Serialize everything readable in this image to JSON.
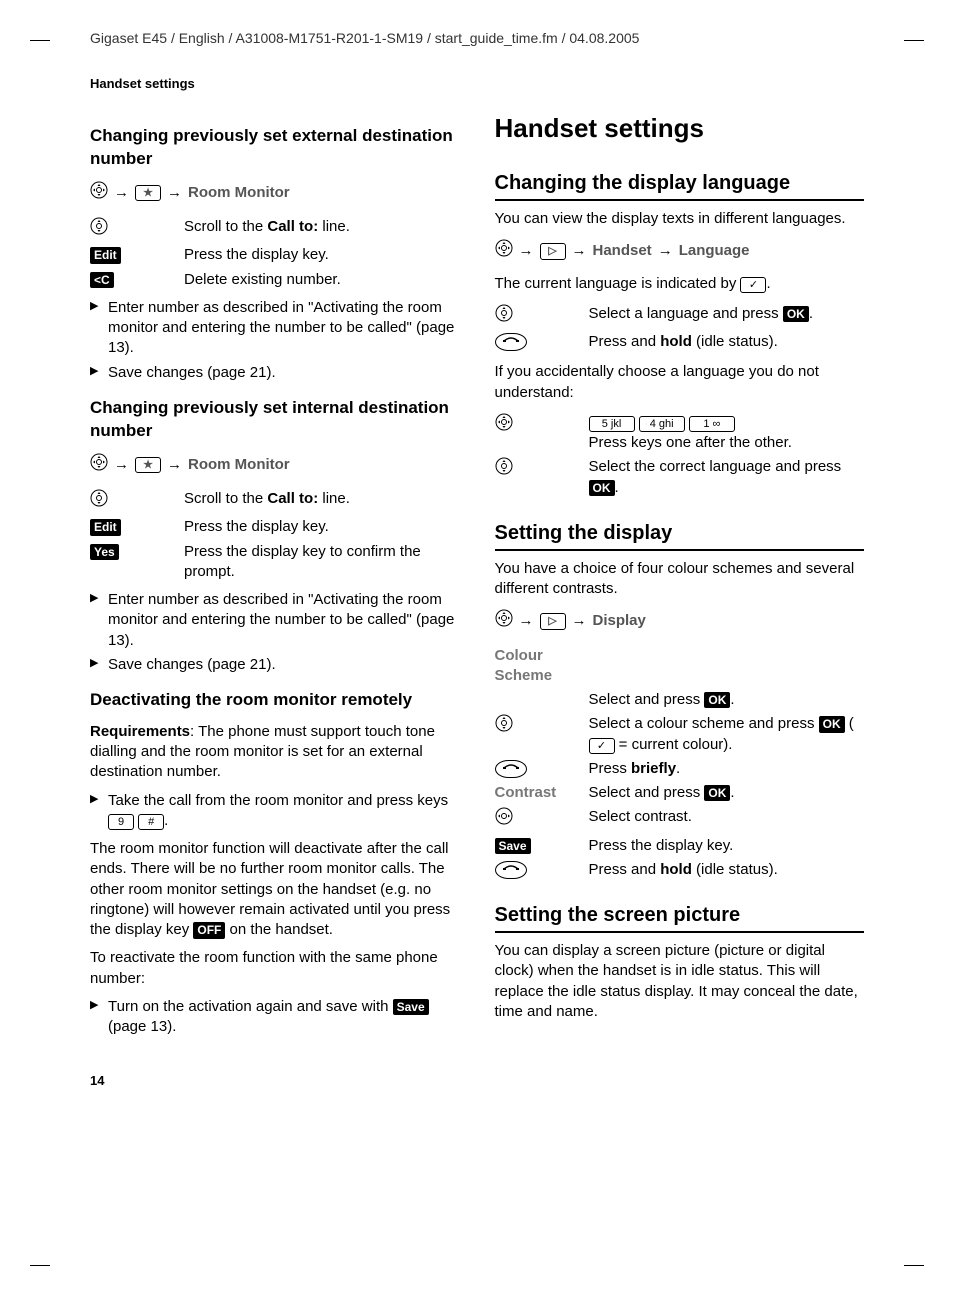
{
  "header": "Gigaset E45 / English / A31008-M1751-R201-1-SM19 / start_guide_time.fm / 04.08.2005",
  "running_head": "Handset settings",
  "page_number": "14",
  "icons": {
    "nav_wheel": "nav-wheel-icon",
    "arrow": "→",
    "star_box": "★",
    "menu_box": "▷",
    "hangup": "hangup-icon",
    "check_box": "✓"
  },
  "left": {
    "h3a": "Changing previously set external destination number",
    "path_a_item": "Room Monitor",
    "rows_a": [
      {
        "k": "nav",
        "t": "Scroll to the ",
        "t2": "Call to:",
        "t3": " line."
      },
      {
        "k": "Edit",
        "t": "Press the display key."
      },
      {
        "k": "clear",
        "t": "Delete existing number."
      }
    ],
    "bullets_a": [
      "Enter number as described in \"Activating the room monitor and entering the number to be called\" (page 13).",
      "Save changes (page 21)."
    ],
    "h3b": "Changing previously set internal destination number",
    "path_b_item": "Room Monitor",
    "rows_b": [
      {
        "k": "nav",
        "t": "Scroll to the ",
        "t2": "Call to:",
        "t3": " line."
      },
      {
        "k": "Edit",
        "t": "Press the display key."
      },
      {
        "k": "Yes",
        "t": "Press the display key to confirm the prompt."
      }
    ],
    "bullets_b": [
      "Enter number as described in \"Activating the room monitor and entering the number to be called\" (page 13).",
      "Save changes (page 21)."
    ],
    "h3c": "Deactivating the room monitor remotely",
    "req_label": "Requirements",
    "req_text": ": The phone must support touch tone dialling and the room monitor is set for an external destination number.",
    "bullet_c1_a": "Take the call from the room monitor and press keys ",
    "bullet_c1_keys": [
      "9",
      "#"
    ],
    "bullet_c1_b": ".",
    "para_c2_a": "The room monitor function will deactivate after the call ends. There will be no further room monitor calls. The other room monitor settings on the handset (e.g. no ringtone) will however remain activated until you press the display key ",
    "para_c2_key": "OFF",
    "para_c2_b": " on the handset.",
    "para_c3": "To reactivate the room function with the same phone number:",
    "bullet_c4_a": "Turn on the activation again and save with ",
    "bullet_c4_key": "Save",
    "bullet_c4_b": " (page 13)."
  },
  "right": {
    "h1": "Handset settings",
    "h2a": "Changing the display language",
    "p_a1": "You can view the display texts in different languages.",
    "path_a": [
      "Handset",
      "Language"
    ],
    "p_a2_a": "The current language is indicated by ",
    "p_a2_b": ".",
    "rows_a": [
      {
        "k": "nav",
        "t_a": "Select a language and press ",
        "key": "OK",
        "t_b": "."
      },
      {
        "k": "hangup",
        "t_a": "Press and ",
        "bold": "hold",
        "t_b": " (idle status)."
      }
    ],
    "p_a3": "If you accidentally choose a language you do not understand:",
    "key_seq": [
      "5 jkl",
      "4 ghi",
      "1 ∞"
    ],
    "key_seq_text": "Press keys one after the other.",
    "rows_a2": [
      {
        "k": "nav",
        "t_a": "Select the correct language and press ",
        "key": "OK",
        "t_b": "."
      }
    ],
    "h2b": "Setting the display",
    "p_b1": "You have a choice of four colour schemes and several different contrasts.",
    "path_b": [
      "Display"
    ],
    "rows_b": [
      {
        "label": "Colour Scheme",
        "t": ""
      },
      {
        "k": "",
        "t_a": "Select and press ",
        "key": "OK",
        "t_b": "."
      },
      {
        "k": "nav",
        "t_a": "Select a colour scheme and press ",
        "key": "OK",
        "t_b": " (",
        "check": true,
        "t_c": " = current colour)."
      },
      {
        "k": "hangup",
        "t_a": "Press ",
        "bold": "briefly",
        "t_b": "."
      },
      {
        "label": "Contrast",
        "t_a": "Select and press ",
        "key": "OK",
        "t_b": "."
      },
      {
        "k": "nav-h",
        "t": "Select contrast."
      },
      {
        "k": "Save",
        "t": "Press the display key."
      },
      {
        "k": "hangup",
        "t_a": "Press and ",
        "bold": "hold",
        "t_b": " (idle status)."
      }
    ],
    "h2c": "Setting the screen picture",
    "p_c1": "You can display a screen picture (picture or digital clock) when the handset is in idle status. This will replace the idle status display. It may conceal the date, time and name."
  }
}
